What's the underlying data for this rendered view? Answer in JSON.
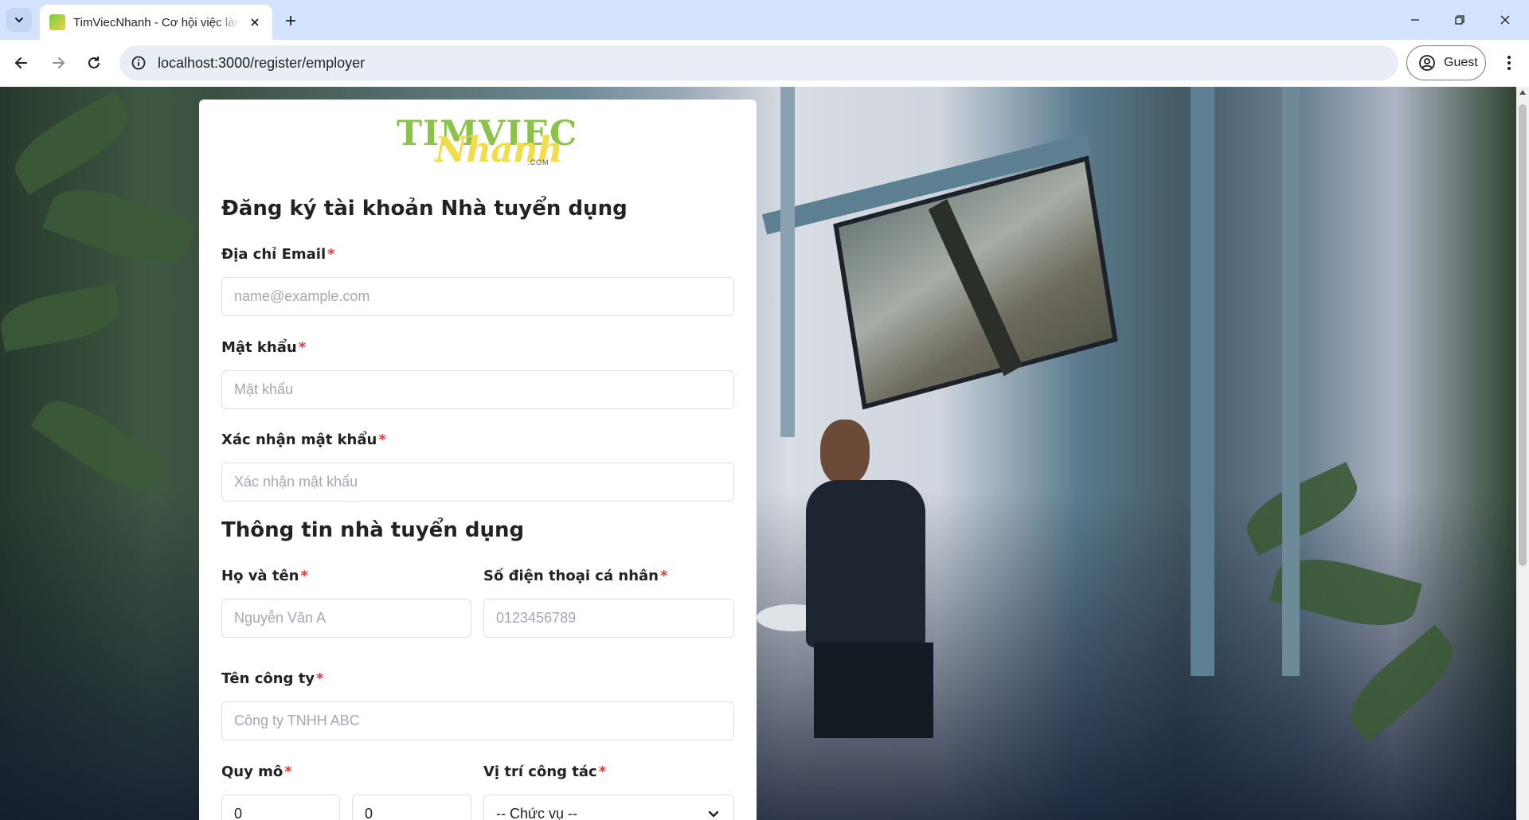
{
  "browser": {
    "tab_title": "TimViecNhanh - Cơ hội việc làm",
    "url": "localhost:3000/register/employer",
    "profile_label": "Guest"
  },
  "logo": {
    "main": "TIMVIEC",
    "script": "Nhanh",
    "suffix": ".COM"
  },
  "form": {
    "title": "Đăng ký tài khoản Nhà tuyển dụng",
    "required_mark": "*",
    "email": {
      "label": "Địa chỉ Email",
      "placeholder": "name@example.com"
    },
    "password": {
      "label": "Mật khẩu",
      "placeholder": "Mật khẩu"
    },
    "confirm_password": {
      "label": "Xác nhận mật khẩu",
      "placeholder": "Xác nhận mật khẩu"
    },
    "section_title": "Thông tin nhà tuyển dụng",
    "full_name": {
      "label": "Họ và tên",
      "placeholder": "Nguyễn Văn A"
    },
    "phone": {
      "label": "Số điện thoại cá nhân",
      "placeholder": "0123456789"
    },
    "company": {
      "label": "Tên công ty",
      "placeholder": "Công ty TNHH ABC"
    },
    "scale": {
      "label": "Quy mô",
      "min_value": "0",
      "max_value": "0"
    },
    "position": {
      "label": "Vị trí công tác",
      "selected": "-- Chức vụ --"
    }
  },
  "icons": {
    "tab_menu": "chevron-down-icon",
    "close_tab": "close-icon",
    "new_tab": "plus-icon",
    "back": "arrow-left-icon",
    "forward": "arrow-right-icon",
    "reload": "reload-icon",
    "site_info": "info-icon",
    "profile": "account-circle-icon",
    "menu": "kebab-menu-icon"
  },
  "colors": {
    "tabbar_bg": "#d3e3fd",
    "required": "#e53935",
    "logo_green": "#8bc34a",
    "logo_yellow": "#f2dc4b"
  }
}
